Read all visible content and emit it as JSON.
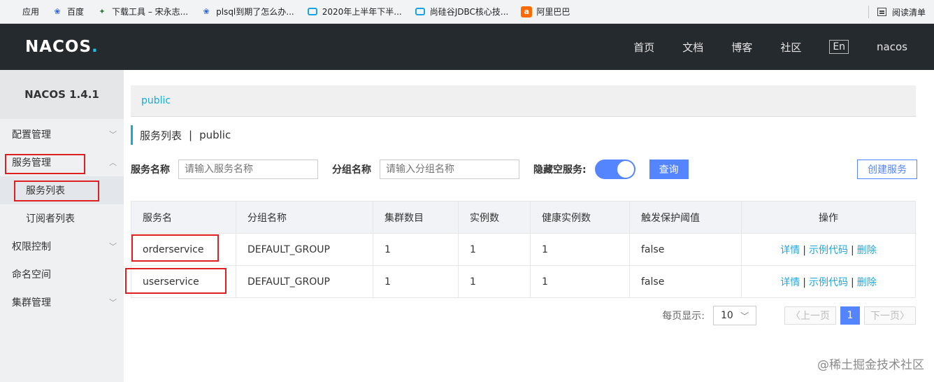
{
  "bookmarks": [
    {
      "label": "应用",
      "icon": "apps-icon"
    },
    {
      "label": "百度",
      "icon": "baidu-paw-icon"
    },
    {
      "label": "下载工具 – 宋永志...",
      "icon": "leaf-icon"
    },
    {
      "label": "plsql到期了怎么办...",
      "icon": "baidu-paw-icon"
    },
    {
      "label": "2020年上半年下半...",
      "icon": "bilibili-tv-icon"
    },
    {
      "label": "尚硅谷JDBC核心技...",
      "icon": "bilibili-tv-icon"
    },
    {
      "label": "阿里巴巴",
      "icon": "alibaba-icon"
    }
  ],
  "reading_list": "阅读清单",
  "header": {
    "logo": "NACOS",
    "logo_dot": ".",
    "nav": [
      "首页",
      "文档",
      "博客",
      "社区"
    ],
    "lang": "En",
    "user": "nacos"
  },
  "sidebar": {
    "title": "NACOS 1.4.1",
    "menu": {
      "config": "配置管理",
      "service": "服务管理",
      "service_list": "服务列表",
      "subscribers": "订阅者列表",
      "auth": "权限控制",
      "namespace": "命名空间",
      "cluster": "集群管理"
    }
  },
  "main": {
    "namespace": "public",
    "title": "服务列表",
    "title_sep": "|",
    "title_ns": "public",
    "filters": {
      "service_name_label": "服务名称",
      "service_name_placeholder": "请输入服务名称",
      "group_name_label": "分组名称",
      "group_name_placeholder": "请输入分组名称",
      "hide_empty_label": "隐藏空服务:",
      "hide_empty_on": true,
      "query": "查询",
      "create": "创建服务"
    },
    "table": {
      "headers": [
        "服务名",
        "分组名称",
        "集群数目",
        "实例数",
        "健康实例数",
        "触发保护阈值",
        "操作"
      ],
      "rows": [
        {
          "name": "orderservice",
          "group": "DEFAULT_GROUP",
          "clusters": "1",
          "instances": "1",
          "healthy": "1",
          "threshold": "false"
        },
        {
          "name": "userservice",
          "group": "DEFAULT_GROUP",
          "clusters": "1",
          "instances": "1",
          "healthy": "1",
          "threshold": "false"
        }
      ],
      "ops": {
        "detail": "详情",
        "sample": "示例代码",
        "delete": "删除",
        "sep": "|"
      }
    },
    "pager": {
      "per_page_label": "每页显示:",
      "per_page": "10",
      "prev": "上一页",
      "current": "1",
      "next": "下一页"
    }
  },
  "watermark": "@稀土掘金技术社区",
  "colors": {
    "accent": "#5584ff",
    "link": "#19a8d9",
    "header_bg": "#252a2f",
    "highlight_box": "#e02020"
  }
}
